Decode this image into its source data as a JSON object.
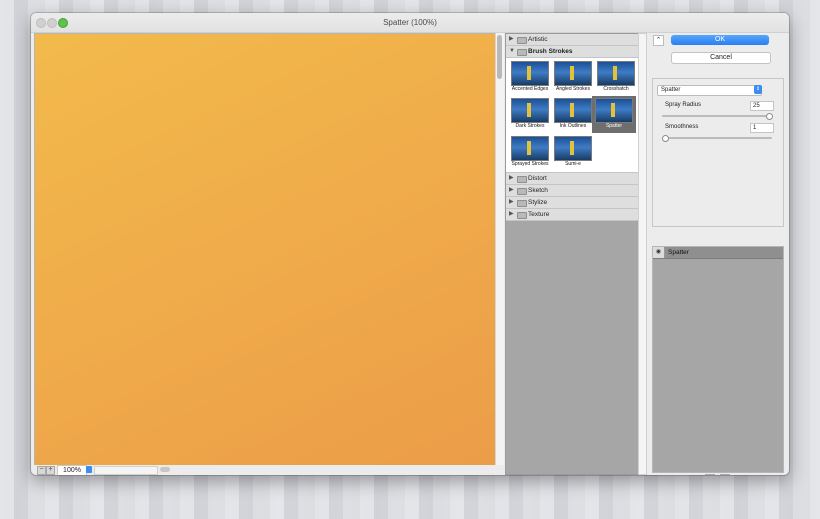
{
  "window": {
    "title": "Spatter (100%)"
  },
  "preview": {
    "zoom": "100%",
    "zoom_out": "−",
    "zoom_in": "+"
  },
  "gallery": {
    "categories_top": [
      {
        "label": "Artistic",
        "expanded": false
      },
      {
        "label": "Brush Strokes",
        "expanded": true
      }
    ],
    "thumbs": [
      {
        "label": "Accented Edges",
        "selected": false
      },
      {
        "label": "Angled Strokes",
        "selected": false
      },
      {
        "label": "Crosshatch",
        "selected": false
      },
      {
        "label": "Dark Strokes",
        "selected": false
      },
      {
        "label": "Ink Outlines",
        "selected": false
      },
      {
        "label": "Spatter",
        "selected": true
      },
      {
        "label": "Sprayed Strokes",
        "selected": false
      },
      {
        "label": "Sumi-e",
        "selected": false
      }
    ],
    "categories_bottom": [
      {
        "label": "Distort"
      },
      {
        "label": "Sketch"
      },
      {
        "label": "Stylize"
      },
      {
        "label": "Texture"
      }
    ]
  },
  "panel": {
    "collapse": "⌃",
    "ok": "OK",
    "cancel": "Cancel",
    "filter_select": "Spatter",
    "params": [
      {
        "label": "Spray Radius",
        "value": "25",
        "fraction": 1.0
      },
      {
        "label": "Smoothness",
        "value": "1",
        "fraction": 0.0
      }
    ],
    "layers": [
      {
        "label": "Spatter"
      }
    ],
    "new_layer_icon": "new-layer-icon",
    "delete_layer_icon": "trash-icon"
  },
  "colors": {
    "preview_start": "#f2ba4b",
    "preview_end": "#eb9d48",
    "accent": "#2a7ef4"
  }
}
